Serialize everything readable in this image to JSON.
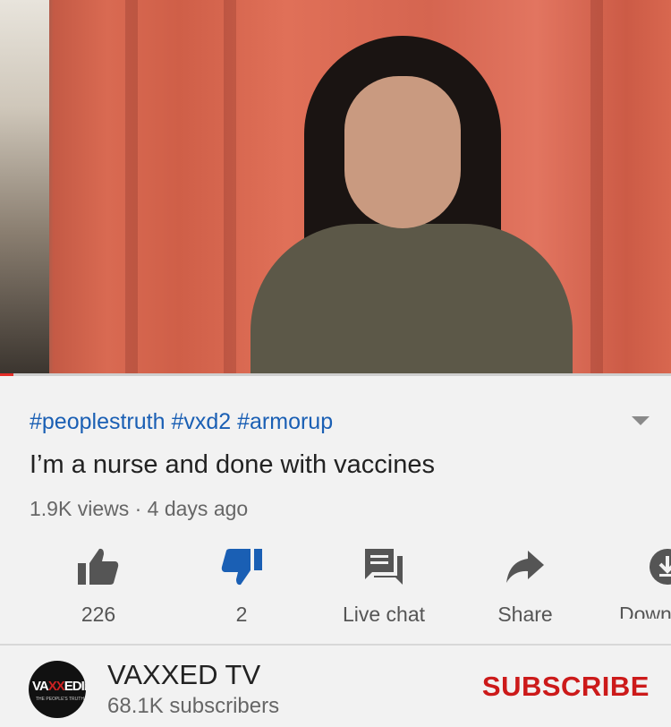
{
  "video": {
    "description_tags": "#peoplestruth #vxd2 #armorup",
    "title": "I’m a nurse and done with vaccines",
    "views": "1.9K views",
    "separator": "·",
    "age": "4 days ago",
    "progress": 0.02,
    "expand_icon": "chevron-down-icon"
  },
  "actions": [
    {
      "icon": "thumbs-up-icon",
      "label": "226"
    },
    {
      "icon": "thumbs-down-icon",
      "label": "2",
      "active_color": "#1a5fb4"
    },
    {
      "icon": "live-chat-icon",
      "label": "Live chat"
    },
    {
      "icon": "share-icon",
      "label": "Share"
    },
    {
      "icon": "download-icon",
      "label": "Down"
    }
  ],
  "channel": {
    "name": "VAXXED TV",
    "subscribers": "68.1K subscribers",
    "subscribe_label": "SUBSCRIBE",
    "avatar_text_a": "VA",
    "avatar_text_b": "XX",
    "avatar_text_c": "ED",
    "avatar_text_d": "II",
    "avatar_tagline": "THE PEOPLE'S TRUTH"
  },
  "colors": {
    "link": "#1a5fb4",
    "subscribe": "#cc1a1a",
    "progress": "#e52d27"
  }
}
